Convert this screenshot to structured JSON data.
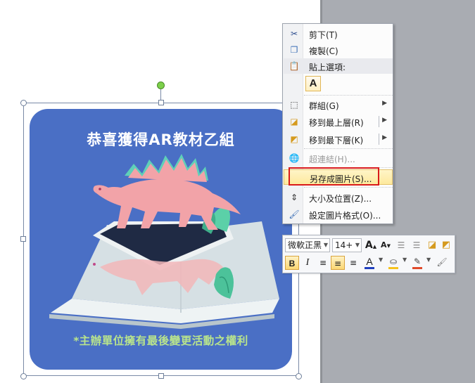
{
  "picture": {
    "title": "恭喜獲得AR教材乙組",
    "footer": "*主辦單位擁有最後變更活動之權利",
    "colors": {
      "background": "#4a6fc5",
      "title": "#ffffff",
      "footer": "#b9e48c",
      "dinosaur": "#f2a3a8",
      "spikes": "#5fd0b8"
    }
  },
  "context_menu": {
    "items": [
      {
        "icon": "scissors-icon",
        "label": "剪下(T)"
      },
      {
        "icon": "copy-icon",
        "label": "複製(C)"
      },
      {
        "icon": "paste-icon",
        "label": "貼上選項:"
      },
      {
        "icon": "group-icon",
        "label": "群組(G)"
      },
      {
        "icon": "bring-to-front-icon",
        "label": "移到最上層(R)"
      },
      {
        "icon": "send-to-back-icon",
        "label": "移到最下層(K)"
      },
      {
        "icon": "hyperlink-icon",
        "label": "超連結(H)..."
      },
      {
        "icon": "",
        "label": "另存成圖片(S)..."
      },
      {
        "icon": "size-position-icon",
        "label": "大小及位置(Z)..."
      },
      {
        "icon": "format-picture-icon",
        "label": "設定圖片格式(O)..."
      }
    ],
    "paste_option_label": "A",
    "highlight_color": "#fde99d",
    "callout_color": "#d91a1a"
  },
  "mini_toolbar": {
    "font_name": "微軟正黑",
    "font_size": "14+",
    "grow_font": "A",
    "shrink_font": "A",
    "bold": "B",
    "italic": "I",
    "font_color_label": "A",
    "font_color": "#1f3fbf",
    "fill_color": "#f6c21c",
    "line_color": "#e04a2a"
  }
}
